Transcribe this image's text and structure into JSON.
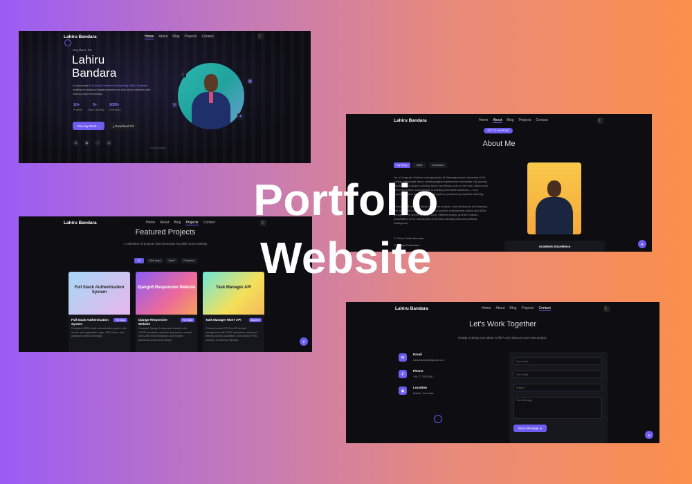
{
  "overlay": {
    "line1": "Portfolio",
    "line2": "Website"
  },
  "colors": {
    "accent": "#6d5cf0",
    "panel_bg": "#0d0d12"
  },
  "nav": {
    "brand": "Lahiru Bandara",
    "items": [
      "Home",
      "About",
      "Blog",
      "Projects",
      "Contact"
    ],
    "theme_icon": "moon-icon"
  },
  "hero": {
    "greeting": "Hey there, I'm",
    "name_line1": "Lahiru",
    "name_line2": "Bandara",
    "bio_pre": "A passionate ",
    "bio_role1": "Full-Stack Developer",
    "bio_mid": " & ",
    "bio_role2": "Aspiring AI/ML Engineer",
    "bio_post": " crafting exceptional digital experiences that blend creativity with cutting-edge technology.",
    "stats": [
      {
        "value": "10+",
        "label": "Projects"
      },
      {
        "value": "3+",
        "label": "Years Learning"
      },
      {
        "value": "100%",
        "label": "Dedication"
      }
    ],
    "primary_btn": "View My Work",
    "secondary_btn": "Download CV",
    "scroll_hint": "Scroll to explore"
  },
  "about": {
    "badge": "GET TO KNOW ME",
    "title": "About Me",
    "tabs": [
      "My Story",
      "Skills",
      "Education"
    ],
    "para1": "I'm a Computer Science undergraduate at Sabaragamuwa University of Sri Lanka, passionate about creating digital experiences that matter. My journey started with a simple curiosity about how things work on the web, which soon grew into a deep commitment to building innovative solutions — from responsive web apps to intelligent systems powered by machine learning.",
    "para2": "Through self-directed study, hands-on projects, and continuous self-learning, I've cultivated a strong foundation in modern development stacks and AI/ML principles. I'm driven by clean code, efficient design, and the endless possibilities at the intersection of frontend development and artificial intelligence.",
    "traits": [
      "Clean Code Advocate",
      "Design Enthusiast"
    ],
    "card_label": "Academic Excellence"
  },
  "projects": {
    "title": "Featured Projects",
    "subtitle": "A collection of projects that showcase my skills and creativity",
    "filters": [
      "All",
      "Web Apps",
      "SaaS",
      "Frontend"
    ],
    "cards": [
      {
        "thumb": "Full Stack Authentication System",
        "title": "Full Stack Authentication System",
        "badge": "Full Stack",
        "desc": "Complete MERN stack authentication system with secure user registration, login, JWT tokens, and password reset functionality."
      },
      {
        "thumb": "Django5 Responsive Website",
        "title": "Django Responsive Website",
        "badge": "Full Stack",
        "desc": "Complete Django 5 responsive website with CRUD operations, dynamic blog system, contact forms with email integration, and modern dashboard-powered UI design."
      },
      {
        "thumb": "Task Manager API",
        "title": "Task Manager REST API",
        "badge": "Backend",
        "desc": "Comprehensive RESTful API for task management with CRUD operations, advanced filtering, sorting capabilities, and modern HTML interface for testing endpoints."
      }
    ]
  },
  "contact": {
    "title": "Let's Work Together",
    "subtitle": "Ready to bring your ideas to life? Let's discuss your next project.",
    "items": [
      {
        "label": "Email",
        "value": "lahirubandara@gmail.com",
        "icon": "mail-icon"
      },
      {
        "label": "Phone",
        "value": "+94 77 7525 080",
        "icon": "phone-icon"
      },
      {
        "label": "Location",
        "value": "Matale, Sri Lanka",
        "icon": "location-icon"
      }
    ],
    "form": {
      "name_placeholder": "Your Name",
      "email_placeholder": "Your Email",
      "subject_placeholder": "Subject",
      "message_placeholder": "Your Message",
      "send_btn": "Send Message"
    }
  }
}
